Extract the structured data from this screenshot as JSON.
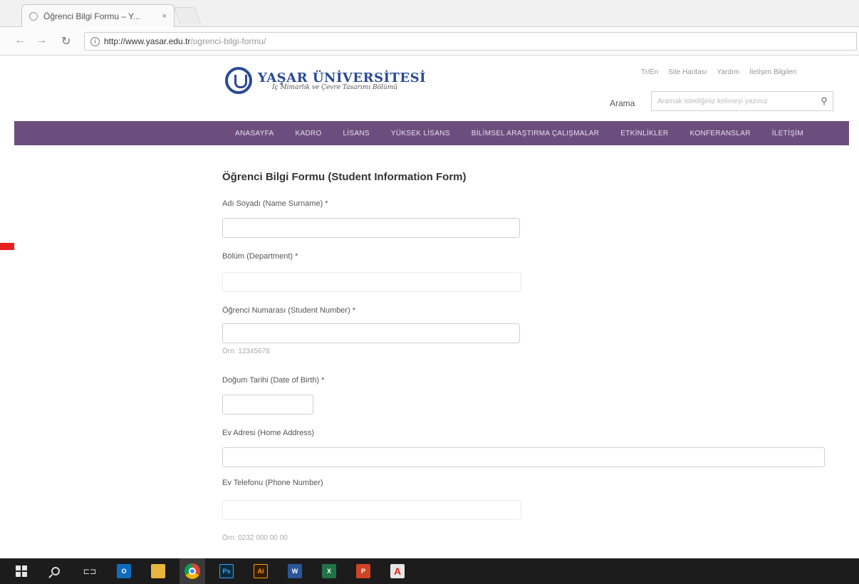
{
  "browser": {
    "tab_title": "Öğrenci Bilgi Formu – Y...",
    "tab_close": "×",
    "url_host": "http://www.yasar.edu.tr",
    "url_path": "/ogrenci-bilgi-formu/"
  },
  "header": {
    "logo_title": "YAŞAR ÜNİVERSİTESİ",
    "logo_subtitle": "İç Mimarlık ve Çevre Tasarımı Bölümü",
    "top_links": [
      "Tr/En",
      "Site Haritası",
      "Yardım",
      "İletişim Bilgileri"
    ],
    "search_label": "Arama",
    "search_placeholder": "Aramak istediğiniz kelimeyi yazınız",
    "search_icon": "search-icon"
  },
  "menu": {
    "items": [
      "ANASAYFA",
      "KADRO",
      "LİSANS",
      "YÜKSEK LİSANS",
      "BİLİMSEL ARAŞTIRMA ÇALIŞMALAR",
      "ETKİNLİKLER",
      "KONFERANSLAR",
      "İLETİŞİM"
    ]
  },
  "form": {
    "title": "Öğrenci Bilgi Formu (Student Information Form)",
    "fields": [
      {
        "label": "Adı Soyadı (Name Surname) *"
      },
      {
        "label": "Bölüm (Department) *"
      },
      {
        "label": "Öğrenci Numarası (Student Number) *",
        "hint": "Örn: 12345678"
      },
      {
        "label": "Doğum Tarihi (Date of Birth) *"
      },
      {
        "label": "Ev Adresi (Home Address)"
      },
      {
        "label": "Ev Telefonu (Phone Number)",
        "hint": "Örn: 0232 000 00 00"
      }
    ]
  },
  "taskbar": {
    "items": [
      "windows-start-icon",
      "search-icon",
      "task-view-icon",
      "outlook-icon",
      "file-explorer-icon",
      "chrome-icon",
      "photoshop-icon",
      "illustrator-icon",
      "word-icon",
      "excel-icon",
      "powerpoint-icon",
      "acrobat-icon"
    ],
    "labels": {
      "task_view": "⊏⊐",
      "outlook": "O",
      "photoshop": "Ps",
      "illustrator": "Ai",
      "word": "W",
      "excel": "X",
      "powerpoint": "P",
      "acrobat": "A"
    }
  },
  "colors": {
    "menu_bg": "#6c4e7e",
    "brand_blue": "#2a4a93",
    "marker": "#e8201e"
  }
}
